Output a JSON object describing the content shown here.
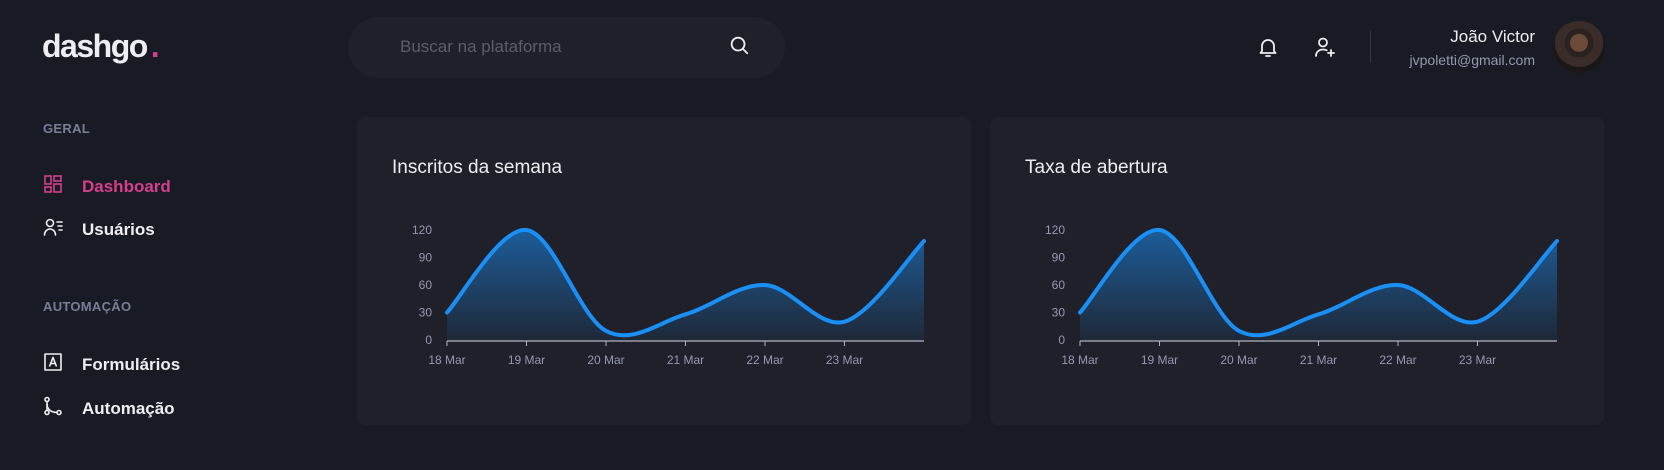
{
  "logo": {
    "text": "dashgo",
    "dot": "."
  },
  "search": {
    "placeholder": "Buscar na plataforma"
  },
  "header": {
    "icons": [
      "bell-icon",
      "user-add-icon"
    ],
    "user": {
      "name": "João Victor",
      "email": "jvpoletti@gmail.com"
    }
  },
  "sidebar": {
    "sections": [
      {
        "title": "GERAL",
        "items": [
          {
            "label": "Dashboard",
            "icon": "dashboard-icon",
            "active": true
          },
          {
            "label": "Usuários",
            "icon": "users-icon",
            "active": false
          }
        ]
      },
      {
        "title": "AUTOMAÇÃO",
        "items": [
          {
            "label": "Formulários",
            "icon": "form-icon",
            "active": false
          },
          {
            "label": "Automação",
            "icon": "git-merge-icon",
            "active": false
          }
        ]
      }
    ]
  },
  "colors": {
    "accent": "#d53f8c",
    "line": "#1a8ff5",
    "background": "#181b23",
    "card": "#1f2029"
  },
  "cards": [
    {
      "title": "Inscritos da semana"
    },
    {
      "title": "Taxa de abertura"
    }
  ],
  "chart_data": [
    {
      "type": "area",
      "title": "Inscritos da semana",
      "categories": [
        "18 Mar",
        "19 Mar",
        "20 Mar",
        "21 Mar",
        "22 Mar",
        "23 Mar"
      ],
      "x": [
        0,
        1,
        2,
        3,
        4,
        5,
        6
      ],
      "values": [
        30,
        120,
        10,
        28,
        60,
        20,
        108
      ],
      "yticks": [
        0,
        30,
        60,
        90,
        120
      ],
      "ylim": [
        0,
        120
      ],
      "grid": false,
      "xlabel": "",
      "ylabel": ""
    },
    {
      "type": "area",
      "title": "Taxa de abertura",
      "categories": [
        "18 Mar",
        "19 Mar",
        "20 Mar",
        "21 Mar",
        "22 Mar",
        "23 Mar"
      ],
      "x": [
        0,
        1,
        2,
        3,
        4,
        5,
        6
      ],
      "values": [
        30,
        120,
        10,
        28,
        60,
        20,
        108
      ],
      "yticks": [
        0,
        30,
        60,
        90,
        120
      ],
      "ylim": [
        0,
        120
      ],
      "grid": false,
      "xlabel": "",
      "ylabel": ""
    }
  ]
}
